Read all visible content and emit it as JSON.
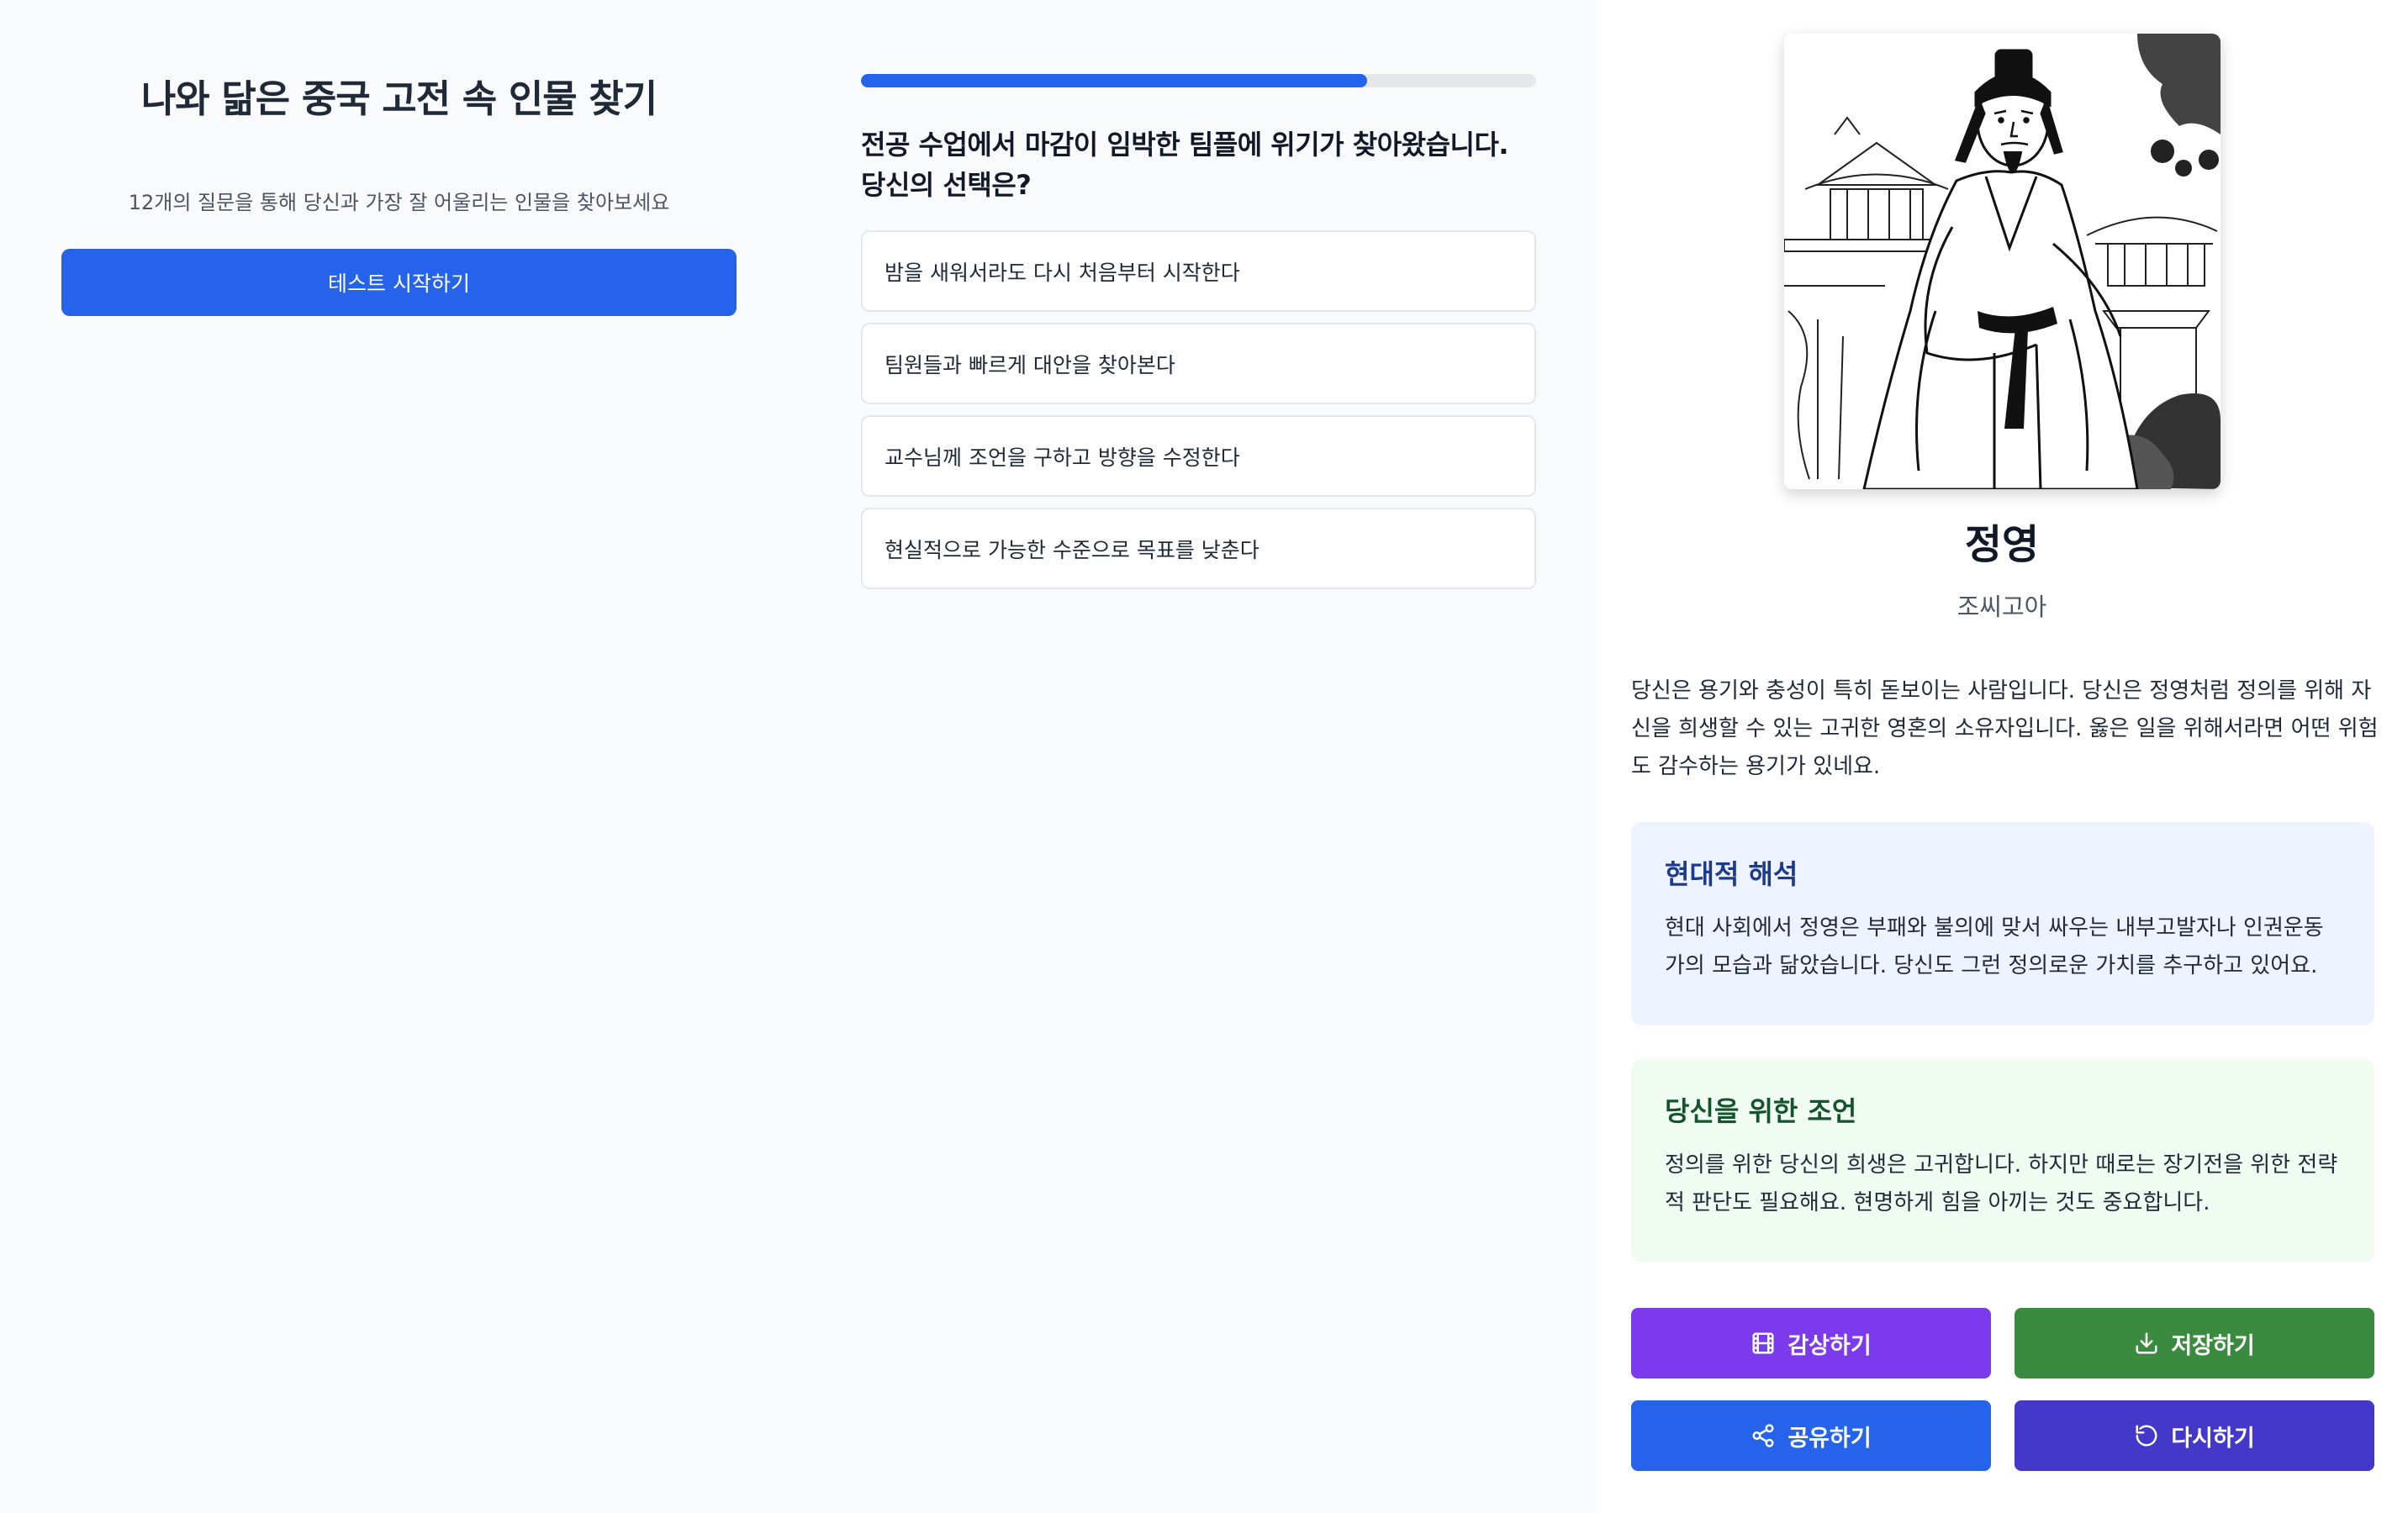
{
  "intro": {
    "title": "나와 닮은 중국 고전 속 인물 찾기",
    "subtitle": "12개의 질문을 통해 당신과 가장 잘 어울리는 인물을 찾아보세요",
    "start_button": "테스트 시작하기"
  },
  "quiz": {
    "progress_fraction": 0.75,
    "question": "전공 수업에서 마감이 임박한 팀플에 위기가 찾아왔습니다. 당신의 선택은?",
    "options": [
      "밤을 새워서라도 다시 처음부터 시작한다",
      "팀원들과 빠르게 대안을 찾아본다",
      "교수님께 조언을 구하고 방향을 수정한다",
      "현실적으로 가능한 수준으로 목표를 낮춘다"
    ]
  },
  "result": {
    "name": "정영",
    "origin": "조씨고아",
    "description": "당신은 용기와 충성이 특히 돋보이는 사람입니다. 당신은 정영처럼 정의를 위해 자신을 희생할 수 있는 고귀한 영혼의 소유자입니다. 옳은 일을 위해서라면 어떤 위험도 감수하는 용기가 있네요.",
    "modern": {
      "title": "현대적 해석",
      "text": "현대 사회에서 정영은 부패와 불의에 맞서 싸우는 내부고발자나 인권운동가의 모습과 닮았습니다. 당신도 그런 정의로운 가치를 추구하고 있어요."
    },
    "advice": {
      "title": "당신을 위한 조언",
      "text": "정의를 위한 당신의 희생은 고귀합니다. 하지만 때로는 장기전을 위한 전략적 판단도 필요해요. 현명하게 힘을 아끼는 것도 중요합니다."
    },
    "buttons": {
      "watch": {
        "label": "감상하기",
        "icon": "film-icon",
        "color": "#7c3aed"
      },
      "save": {
        "label": "저장하기",
        "icon": "download-icon",
        "color": "#3a8a3f"
      },
      "share": {
        "label": "공유하기",
        "icon": "share-icon",
        "color": "#2563eb"
      },
      "retry": {
        "label": "다시하기",
        "icon": "refresh-icon",
        "color": "#4338ca"
      }
    }
  },
  "colors": {
    "primary": "#2563eb",
    "progress_track": "#e5e7eb",
    "modern_card_bg": "#eef4ff",
    "advice_card_bg": "#f0fbf2"
  }
}
